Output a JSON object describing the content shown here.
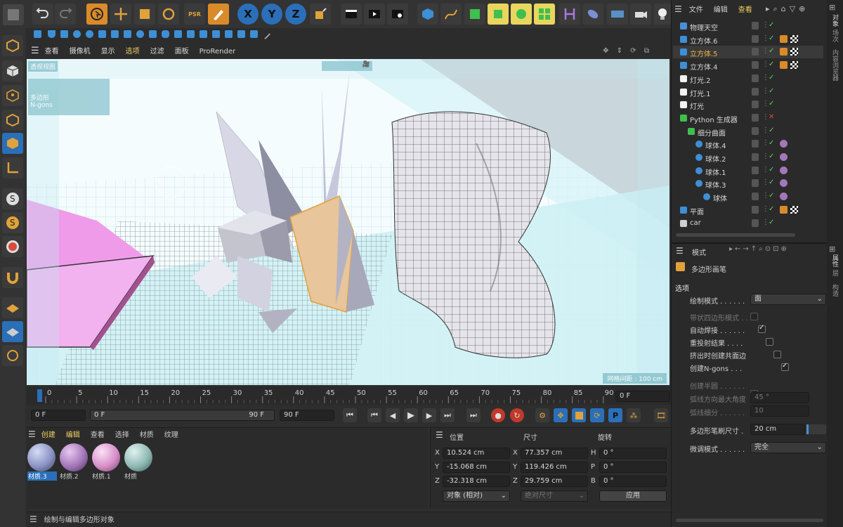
{
  "toolbar": {
    "psr_label": "PSR",
    "axis_x": "X",
    "axis_y": "Y",
    "axis_z": "Z"
  },
  "viewport_menu": [
    "查看",
    "摄像机",
    "显示",
    "选项",
    "过滤",
    "面板",
    "ProRender"
  ],
  "viewport": {
    "label": "透视视图",
    "overlay_lines": [
      "多边形",
      "N-gons"
    ],
    "grid_spacing": "网格间距 : 100 cm"
  },
  "object_manager": {
    "menu": [
      "文件",
      "编辑",
      "查看"
    ],
    "objects": [
      {
        "name": "物理天空",
        "indent": 0,
        "icon": "sky",
        "sel": false
      },
      {
        "name": "立方体.6",
        "indent": 0,
        "icon": "cube",
        "sel": false
      },
      {
        "name": "立方体.5",
        "indent": 0,
        "icon": "cube",
        "sel": true
      },
      {
        "name": "立方体.4",
        "indent": 0,
        "icon": "cube",
        "sel": false
      },
      {
        "name": "灯光.2",
        "indent": 0,
        "icon": "light",
        "sel": false
      },
      {
        "name": "灯光.1",
        "indent": 0,
        "icon": "light",
        "sel": false
      },
      {
        "name": "灯光",
        "indent": 0,
        "icon": "light",
        "sel": false
      },
      {
        "name": "Python 生成器",
        "indent": 0,
        "icon": "python",
        "sel": false
      },
      {
        "name": "细分曲面",
        "indent": 1,
        "icon": "subdiv",
        "sel": false
      },
      {
        "name": "球体.4",
        "indent": 2,
        "icon": "sphere",
        "sel": false
      },
      {
        "name": "球体.2",
        "indent": 2,
        "icon": "sphere",
        "sel": false
      },
      {
        "name": "球体.1",
        "indent": 2,
        "icon": "sphere",
        "sel": false
      },
      {
        "name": "球体.3",
        "indent": 2,
        "icon": "sphere",
        "sel": false
      },
      {
        "name": "球体",
        "indent": 3,
        "icon": "sphere",
        "sel": false
      },
      {
        "name": "平面",
        "indent": 0,
        "icon": "cube",
        "sel": false
      },
      {
        "name": "car",
        "indent": 0,
        "icon": "null",
        "sel": false
      }
    ]
  },
  "right_tabs_top": [
    "对象",
    "场次",
    "内容浏览器"
  ],
  "right_tabs_bottom": [
    "属性",
    "层",
    "构造"
  ],
  "attributes": {
    "header": "模式",
    "tool_name": "多边形画笔",
    "section": "选项",
    "draw_mode_label": "绘制模式 . . . . . .",
    "draw_mode_value": "面",
    "opts": [
      {
        "label": "带状四边形模式 . .",
        "checked": false,
        "disabled": true
      },
      {
        "label": "自动焊接 . . . . . .",
        "checked": true,
        "disabled": false
      },
      {
        "label": "重投射结果 . . . .",
        "checked": false,
        "disabled": false
      },
      {
        "label": "挤出时创建共面边",
        "checked": false,
        "disabled": false
      },
      {
        "label": "创建N-gons . . .",
        "checked": true,
        "disabled": false
      }
    ],
    "half_circle": "创建半圆 . . . . . .",
    "arc_max_label": "弧线方向最大角度",
    "arc_max_value": "45 °",
    "arc_sub_label": "弧线细分 . . . . . .",
    "arc_sub_value": "10",
    "brush_label": "多边形笔刷尺寸 .",
    "brush_value": "20 cm",
    "tweak_label": "微调模式 . . . . . .",
    "tweak_value": "完全"
  },
  "timeline": {
    "ticks": [
      "0",
      "5",
      "10",
      "15",
      "20",
      "25",
      "30",
      "35",
      "40",
      "45",
      "50",
      "55",
      "60",
      "65",
      "70",
      "75",
      "80",
      "85",
      "90"
    ],
    "current": "0 F",
    "start": "0 F",
    "range_start": "0 F",
    "range_end": "90 F",
    "end": "90 F"
  },
  "material_manager": {
    "menu": [
      "创建",
      "编辑",
      "查看",
      "选择",
      "材质",
      "纹理"
    ],
    "materials": [
      {
        "name": "材质.3",
        "color": "#8a93c4"
      },
      {
        "name": "材质.2",
        "color": "#a377b8"
      },
      {
        "name": "材质.1",
        "color": "#d78fc8"
      },
      {
        "name": "材质",
        "color": "#8fb8b4"
      }
    ]
  },
  "coordinates": {
    "col_pos": "位置",
    "col_size": "尺寸",
    "col_rot": "旋转",
    "rows": [
      {
        "axis": "X",
        "pos": "10.524 cm",
        "size_axis": "X",
        "size": "77.357 cm",
        "rot_axis": "H",
        "rot": "0 °"
      },
      {
        "axis": "Y",
        "pos": "-15.068 cm",
        "size_axis": "Y",
        "size": "119.426 cm",
        "rot_axis": "P",
        "rot": "0 °"
      },
      {
        "axis": "Z",
        "pos": "-32.318 cm",
        "size_axis": "Z",
        "size": "29.759 cm",
        "rot_axis": "B",
        "rot": "0 °"
      }
    ],
    "mode": "对象 (相对)",
    "size_mode": "绝对尺寸",
    "apply": "应用"
  },
  "status": "绘制与编辑多边形对象",
  "colors": {
    "accent_blue": "#2a6fb8",
    "highlight_orange": "#e0a23a",
    "bg": "#2e2e2e",
    "viewport_bg": "#dff6fb"
  }
}
